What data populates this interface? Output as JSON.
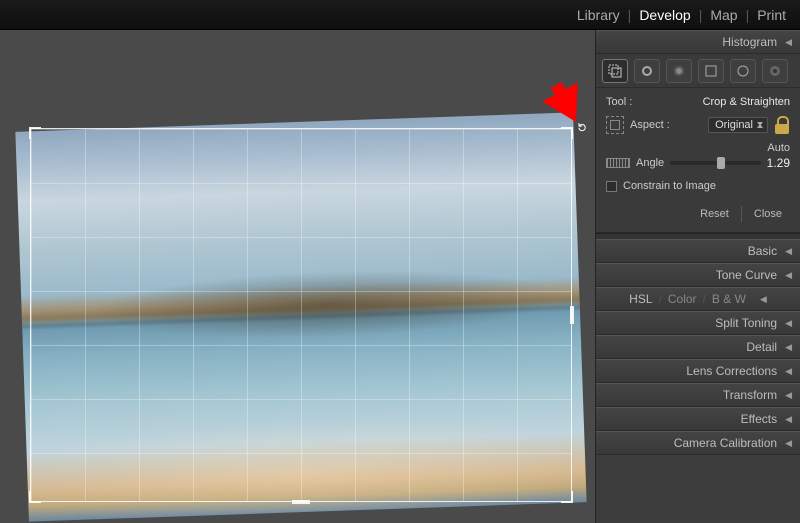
{
  "nav": {
    "library": "Library",
    "develop": "Develop",
    "map": "Map",
    "print": "Print"
  },
  "histogram": {
    "title": "Histogram"
  },
  "crop": {
    "tool_label": "Tool :",
    "tool_name": "Crop & Straighten",
    "aspect_label": "Aspect :",
    "aspect_value": "Original",
    "angle_label": "Angle",
    "auto_label": "Auto",
    "angle_value": "1.29",
    "angle_pct": 52,
    "constrain_label": "Constrain to Image",
    "reset": "Reset",
    "close": "Close"
  },
  "panels": {
    "basic": "Basic",
    "tonecurve": "Tone Curve",
    "hsl": "HSL",
    "color": "Color",
    "bw": "B & W",
    "split": "Split Toning",
    "detail": "Detail",
    "lens": "Lens Corrections",
    "transform": "Transform",
    "effects": "Effects",
    "calibration": "Camera Calibration"
  }
}
